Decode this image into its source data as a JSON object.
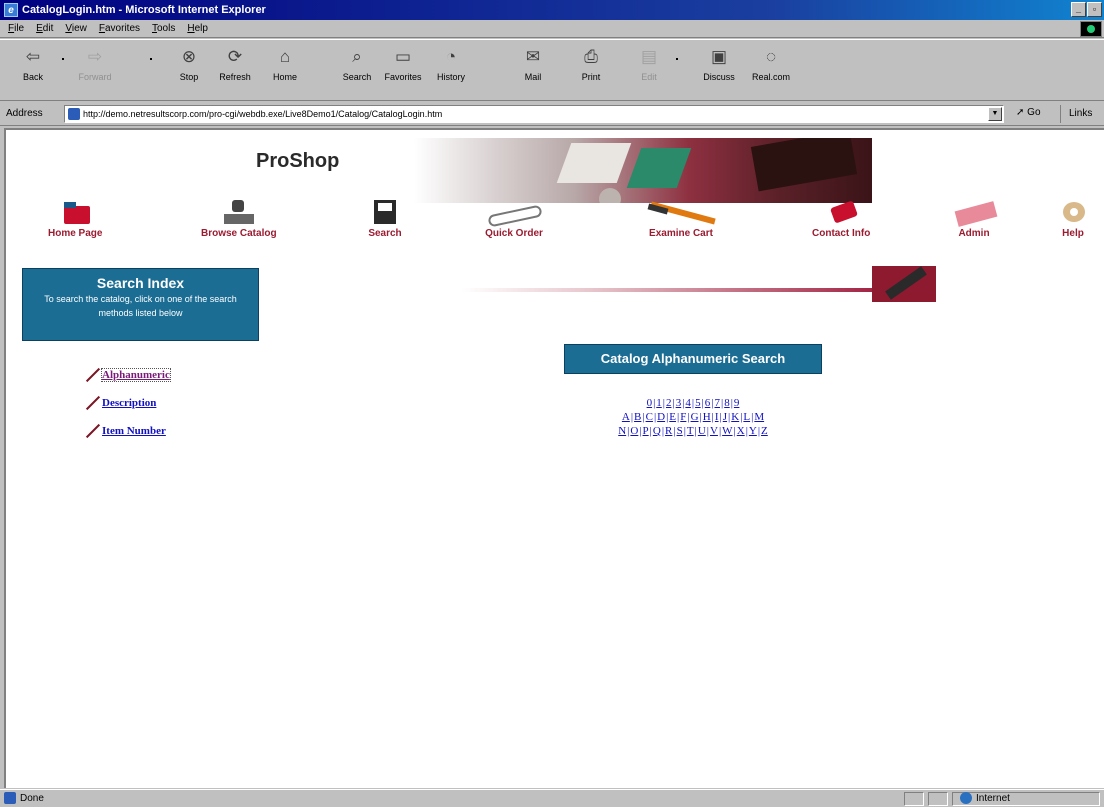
{
  "window": {
    "title": "CatalogLogin.htm - Microsoft Internet Explorer"
  },
  "menu": [
    "File",
    "Edit",
    "View",
    "Favorites",
    "Tools",
    "Help"
  ],
  "toolbar": [
    {
      "label": "Back",
      "icon": "back-arrow-icon",
      "disabled": false
    },
    {
      "label": "Forward",
      "icon": "forward-arrow-icon",
      "disabled": true
    },
    {
      "label": "Stop",
      "icon": "stop-icon",
      "disabled": false
    },
    {
      "label": "Refresh",
      "icon": "refresh-icon",
      "disabled": false
    },
    {
      "label": "Home",
      "icon": "home-icon",
      "disabled": false
    },
    {
      "label": "Search",
      "icon": "search-icon",
      "disabled": false
    },
    {
      "label": "Favorites",
      "icon": "favorites-icon",
      "disabled": false
    },
    {
      "label": "History",
      "icon": "history-icon",
      "disabled": false
    },
    {
      "label": "Mail",
      "icon": "mail-icon",
      "disabled": false
    },
    {
      "label": "Print",
      "icon": "print-icon",
      "disabled": false
    },
    {
      "label": "Edit",
      "icon": "edit-icon",
      "disabled": true
    },
    {
      "label": "Discuss",
      "icon": "discuss-icon",
      "disabled": false
    },
    {
      "label": "Real.com",
      "icon": "real-icon",
      "disabled": false
    }
  ],
  "address": {
    "label": "Address",
    "url": "http://demo.netresultscorp.com/pro-cgi/webdb.exe/Live8Demo1/Catalog/CatalogLogin.htm",
    "go": "Go",
    "links": "Links"
  },
  "page": {
    "brand": "ProShop",
    "nav": [
      {
        "label": "Home Page",
        "icon": "folder-icon"
      },
      {
        "label": "Browse Catalog",
        "icon": "stamp-icon"
      },
      {
        "label": "Search",
        "icon": "floppy-disk-icon"
      },
      {
        "label": "Quick Order",
        "icon": "paperclip-icon"
      },
      {
        "label": "Examine Cart",
        "icon": "pen-icon"
      },
      {
        "label": "Contact Info",
        "icon": "pushpin-icon"
      },
      {
        "label": "Admin",
        "icon": "eraser-icon"
      },
      {
        "label": "Help",
        "icon": "tape-icon"
      }
    ],
    "search_index": {
      "title": "Search Index",
      "description": "To search the catalog, click on one of the search methods listed below"
    },
    "search_links": [
      "Alphanumeric",
      "Description",
      "Item Number"
    ],
    "section_title": "Catalog Alphanumeric Search",
    "alpha_rows": [
      [
        "0",
        "1",
        "2",
        "3",
        "4",
        "5",
        "6",
        "7",
        "8",
        "9"
      ],
      [
        "A",
        "B",
        "C",
        "D",
        "E",
        "F",
        "G",
        "H",
        "I",
        "J",
        "K",
        "L",
        "M"
      ],
      [
        "N",
        "O",
        "P",
        "Q",
        "R",
        "S",
        "T",
        "U",
        "V",
        "W",
        "X",
        "Y",
        "Z"
      ]
    ]
  },
  "status": {
    "text": "Done",
    "zone": "Internet"
  }
}
